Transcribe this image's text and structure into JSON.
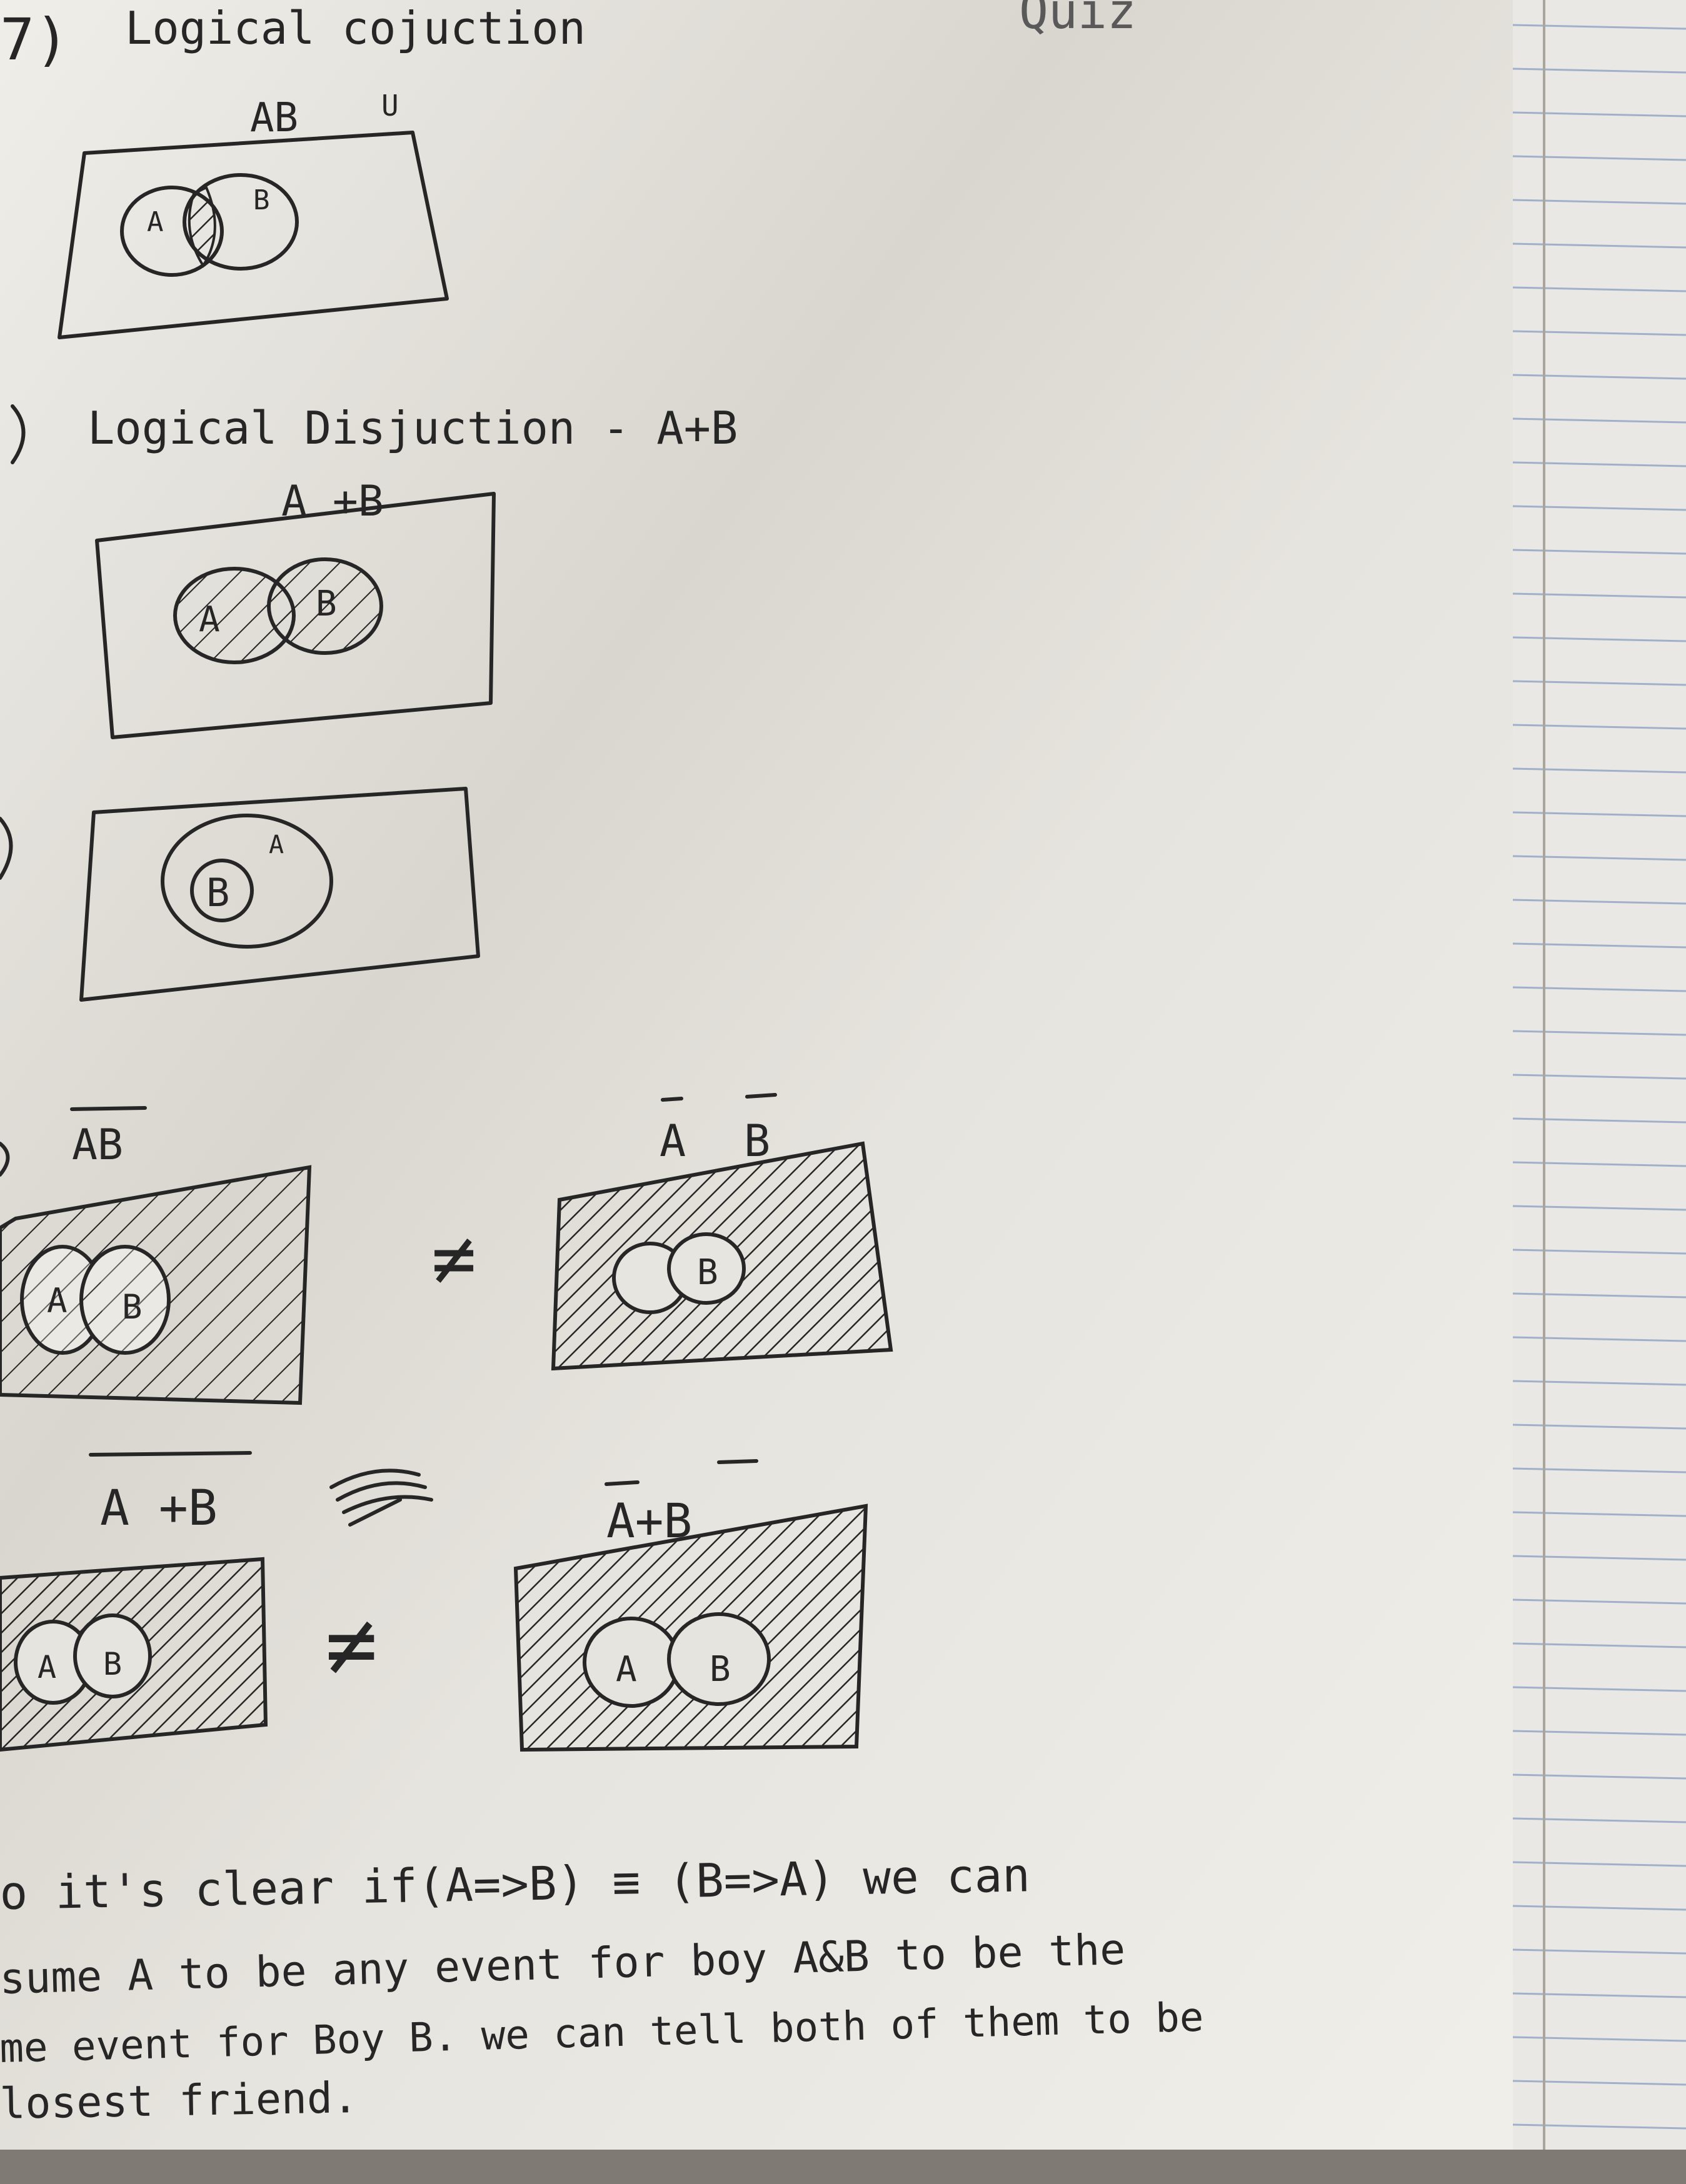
{
  "header": {
    "quiz_label": "Quiz"
  },
  "sections": {
    "conjunction": {
      "number": "7)",
      "title": "Logical cojuction",
      "expression": "AB",
      "universe_mark": "U",
      "circle_a": "A",
      "circle_b": "B"
    },
    "disjunction": {
      "title": "Logical Disjuction - A+B",
      "expression": "A +B",
      "circle_a": "A",
      "circle_b": "B"
    },
    "subset": {
      "outer_label": "A",
      "inner_label": "B"
    },
    "complement_product": {
      "left_expression": "AB",
      "left_circle_a": "A",
      "left_circle_b": "B",
      "not_equal": "≠",
      "right_expression_a": "A",
      "right_expression_b": "B",
      "right_circle_b": "B"
    },
    "complement_sum": {
      "left_expression": "A +B",
      "left_circle_a": "A",
      "left_circle_b": "B",
      "not_equal": "≠",
      "right_expression": "A+B",
      "right_circle_a": "A",
      "right_circle_b": "B"
    }
  },
  "conclusion": {
    "line1": "o it's clear if(A=>B) ≡ (B=>A) we can",
    "line2": "sume A to be any event for boy A&B to be the",
    "line3": "me event for Boy B. we can tell both of them to be",
    "line4": "losest friend."
  },
  "colors": {
    "paper": "#f2f1ed",
    "shadow": "#cfccc4",
    "ink": "#262626",
    "grid_line": "#9fb0c8"
  }
}
